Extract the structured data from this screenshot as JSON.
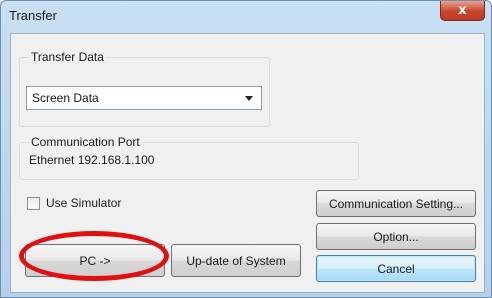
{
  "window": {
    "title": "Transfer",
    "close_glyph": "x"
  },
  "transfer_data": {
    "group_label": "Transfer Data",
    "selected": "Screen Data"
  },
  "communication_port": {
    "label": "Communication Port",
    "value": "Ethernet 192.168.1.100"
  },
  "simulator": {
    "label": "Use Simulator",
    "checked": false
  },
  "buttons": {
    "communication_setting": "Communication Setting...",
    "option": "Option...",
    "pc_transfer": "PC ->",
    "update_system": "Up-date of System",
    "cancel": "Cancel"
  },
  "highlight": {
    "color": "#e01010",
    "target": "pc_transfer"
  }
}
